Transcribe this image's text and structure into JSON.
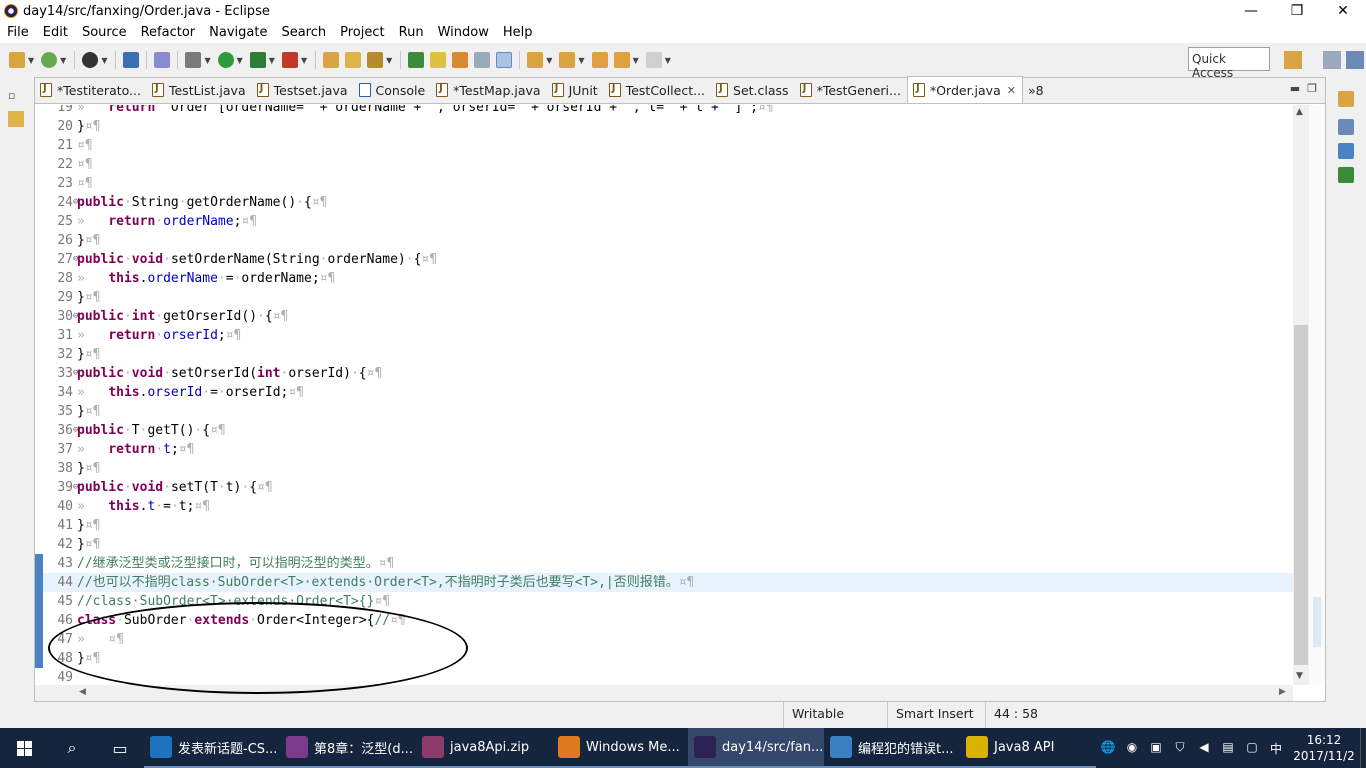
{
  "window": {
    "title": "day14/src/fanxing/Order.java - Eclipse",
    "controls": [
      "—",
      "❐",
      "✕"
    ]
  },
  "menu": [
    "File",
    "Edit",
    "Source",
    "Refactor",
    "Navigate",
    "Search",
    "Project",
    "Run",
    "Window",
    "Help"
  ],
  "toolbar": {
    "quick_access": "Quick Access"
  },
  "tabs": [
    {
      "label": "*Testiterato...",
      "icon": "java-file-icon"
    },
    {
      "label": "TestList.java",
      "icon": "java-file-icon"
    },
    {
      "label": "Testset.java",
      "icon": "java-file-icon"
    },
    {
      "label": "Console",
      "icon": "console-icon"
    },
    {
      "label": "*TestMap.java",
      "icon": "java-file-icon"
    },
    {
      "label": "JUnit",
      "icon": "junit-icon"
    },
    {
      "label": "TestCollect...",
      "icon": "java-file-icon"
    },
    {
      "label": "Set.class",
      "icon": "class-file-icon"
    },
    {
      "label": "*TestGeneri...",
      "icon": "java-file-icon"
    },
    {
      "label": "*Order.java",
      "icon": "java-file-icon",
      "active": true
    }
  ],
  "tab_overflow": "»8",
  "code_lines": [
    {
      "n": "19",
      "html": "<span class=\"ws\">»   </span><span class=\"kw\">return</span> \"Order [orderName=\" + orderName + \", orserId=\" + orserId + \", t=\" + t + \"]\";<span class=\"ws\">¤¶</span>"
    },
    {
      "n": "20",
      "html": "}<span class=\"ws\">¤¶</span>"
    },
    {
      "n": "21",
      "html": "<span class=\"ws\">¤¶</span>"
    },
    {
      "n": "22",
      "html": "<span class=\"ws\">¤¶</span>"
    },
    {
      "n": "23",
      "html": "<span class=\"ws\">¤¶</span>"
    },
    {
      "n": "24",
      "fold": true,
      "html": "<span class=\"kw\">public</span><span class=\"ws\">·</span>String<span class=\"ws\">·</span>getOrderName()<span class=\"ws\">·</span>{<span class=\"ws\">¤¶</span>"
    },
    {
      "n": "25",
      "html": "<span class=\"ws\">»   </span><span class=\"kw\">return</span><span class=\"ws\">·</span><span class=\"fld\">orderName</span>;<span class=\"ws\">¤¶</span>"
    },
    {
      "n": "26",
      "html": "}<span class=\"ws\">¤¶</span>"
    },
    {
      "n": "27",
      "fold": true,
      "html": "<span class=\"kw\">public</span><span class=\"ws\">·</span><span class=\"kw\">void</span><span class=\"ws\">·</span>setOrderName(String<span class=\"ws\">·</span>orderName)<span class=\"ws\">·</span>{<span class=\"ws\">¤¶</span>"
    },
    {
      "n": "28",
      "html": "<span class=\"ws\">»   </span><span class=\"kw\">this</span>.<span class=\"fld\">orderName</span><span class=\"ws\">·</span>=<span class=\"ws\">·</span>orderName;<span class=\"ws\">¤¶</span>"
    },
    {
      "n": "29",
      "html": "}<span class=\"ws\">¤¶</span>"
    },
    {
      "n": "30",
      "fold": true,
      "html": "<span class=\"kw\">public</span><span class=\"ws\">·</span><span class=\"kw\">int</span><span class=\"ws\">·</span>getOrserId()<span class=\"ws\">·</span>{<span class=\"ws\">¤¶</span>"
    },
    {
      "n": "31",
      "html": "<span class=\"ws\">»   </span><span class=\"kw\">return</span><span class=\"ws\">·</span><span class=\"fld\">orserId</span>;<span class=\"ws\">¤¶</span>"
    },
    {
      "n": "32",
      "html": "}<span class=\"ws\">¤¶</span>"
    },
    {
      "n": "33",
      "fold": true,
      "html": "<span class=\"kw\">public</span><span class=\"ws\">·</span><span class=\"kw\">void</span><span class=\"ws\">·</span>setOrserId(<span class=\"kw\">int</span><span class=\"ws\">·</span>orserId)<span class=\"ws\">·</span>{<span class=\"ws\">¤¶</span>"
    },
    {
      "n": "34",
      "html": "<span class=\"ws\">»   </span><span class=\"kw\">this</span>.<span class=\"fld\">orserId</span><span class=\"ws\">·</span>=<span class=\"ws\">·</span>orserId;<span class=\"ws\">¤¶</span>"
    },
    {
      "n": "35",
      "html": "}<span class=\"ws\">¤¶</span>"
    },
    {
      "n": "36",
      "fold": true,
      "html": "<span class=\"kw\">public</span><span class=\"ws\">·</span>T<span class=\"ws\">·</span>getT()<span class=\"ws\">·</span>{<span class=\"ws\">¤¶</span>"
    },
    {
      "n": "37",
      "html": "<span class=\"ws\">»   </span><span class=\"kw\">return</span><span class=\"ws\">·</span><span class=\"fld\">t</span>;<span class=\"ws\">¤¶</span>"
    },
    {
      "n": "38",
      "html": "}<span class=\"ws\">¤¶</span>"
    },
    {
      "n": "39",
      "fold": true,
      "html": "<span class=\"kw\">public</span><span class=\"ws\">·</span><span class=\"kw\">void</span><span class=\"ws\">·</span>setT(T<span class=\"ws\">·</span>t)<span class=\"ws\">·</span>{<span class=\"ws\">¤¶</span>"
    },
    {
      "n": "40",
      "html": "<span class=\"ws\">»   </span><span class=\"kw\">this</span>.<span class=\"fld\">t</span><span class=\"ws\">·</span>=<span class=\"ws\">·</span>t;<span class=\"ws\">¤¶</span>"
    },
    {
      "n": "41",
      "html": "}<span class=\"ws\">¤¶</span>"
    },
    {
      "n": "42",
      "html": "}<span class=\"ws\">¤¶</span>"
    },
    {
      "n": "43",
      "bar": true,
      "html": "<span class=\"cmt\">//继承泛型类或泛型接口时，可以指明泛型的类型。</span><span class=\"ws\">¤¶</span>"
    },
    {
      "n": "44",
      "bar": true,
      "hl": true,
      "html": "<span class=\"cmt\">//也可以不指明class·SubOrder&lt;T&gt;·extends·Order&lt;T&gt;,不指明时子类后也要写&lt;T&gt;,|否则报错。</span><span class=\"ws\">¤¶</span>"
    },
    {
      "n": "45",
      "bar": true,
      "html": "<span class=\"cmt\">//class·SubOrder&lt;T&gt;·extends·Order&lt;T&gt;{}</span><span class=\"ws\">¤¶</span>"
    },
    {
      "n": "46",
      "bar": true,
      "html": "<span class=\"kw\">class</span><span class=\"ws\">·</span>SubOrder<span class=\"ws\">·</span><span class=\"kw\">extends</span><span class=\"ws\">·</span>Order&lt;Integer&gt;{<span class=\"cmt\">//</span><span class=\"ws\">¤¶</span>"
    },
    {
      "n": "47",
      "bar": true,
      "html": "<span class=\"ws\">»   ¤¶</span>"
    },
    {
      "n": "48",
      "bar": true,
      "html": "}<span class=\"ws\">¤¶</span>"
    },
    {
      "n": "49",
      "html": ""
    }
  ],
  "status": {
    "writable": "Writable",
    "insert_mode": "Smart Insert",
    "position": "44 : 58"
  },
  "taskbar": {
    "tasks": [
      {
        "label": "发表新话题-CS...",
        "color": "#1e73be"
      },
      {
        "label": "第8章：泛型(d...",
        "color": "#7a3b8c"
      },
      {
        "label": "java8Api.zip",
        "color": "#8c3b6a"
      },
      {
        "label": "Windows Me...",
        "color": "#e07a1e"
      },
      {
        "label": "day14/src/fan...",
        "color": "#2c2255",
        "active": true
      },
      {
        "label": "编程犯的错误t...",
        "color": "#3a7fc1"
      },
      {
        "label": "Java8 API",
        "color": "#d9b300"
      }
    ],
    "ime": "中",
    "time": "16:12",
    "date": "2017/11/2"
  }
}
